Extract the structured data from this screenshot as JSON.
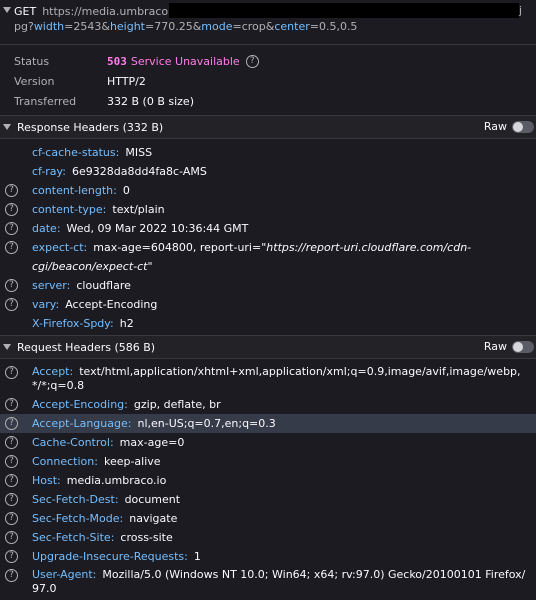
{
  "request_line": {
    "method": "GET",
    "url_prefix": "https://media.umbraco.io",
    "trailing_char": "j",
    "second_line": [
      {
        "text": "pg?",
        "kind": "plain"
      },
      {
        "text": "width",
        "kind": "key"
      },
      {
        "text": "=2543&",
        "kind": "plain"
      },
      {
        "text": "height",
        "kind": "key"
      },
      {
        "text": "=770.25&",
        "kind": "plain"
      },
      {
        "text": "mode",
        "kind": "key"
      },
      {
        "text": "=crop&",
        "kind": "plain"
      },
      {
        "text": "center",
        "kind": "key"
      },
      {
        "text": "=0.5,0.5",
        "kind": "plain"
      }
    ]
  },
  "summary": {
    "status_label": "Status",
    "status_code": "503",
    "status_text": "Service Unavailable",
    "version_label": "Version",
    "version_value": "HTTP/2",
    "transferred_label": "Transferred",
    "transferred_value": "332 B (0 B size)"
  },
  "response_section": {
    "title": "Response Headers (332 B)",
    "raw_label": "Raw",
    "headers": [
      {
        "name": "cf-cache-status",
        "value": "MISS",
        "help": false
      },
      {
        "name": "cf-ray",
        "value": "6e9328da8dd4fa8c-AMS",
        "help": false
      },
      {
        "name": "content-length",
        "value": "0",
        "help": true
      },
      {
        "name": "content-type",
        "value": "text/plain",
        "help": true
      },
      {
        "name": "date",
        "value": "Wed, 09 Mar 2022 10:36:44 GMT",
        "help": true
      },
      {
        "name": "expect-ct",
        "value": "max-age=604800, report-uri=",
        "value_italic": "\"https://report-uri.cloudflare.com/cdn-cgi/beacon/expect-ct\"",
        "help": true
      },
      {
        "name": "server",
        "value": "cloudflare",
        "help": true
      },
      {
        "name": "vary",
        "value": "Accept-Encoding",
        "help": true
      },
      {
        "name": "X-Firefox-Spdy",
        "value": "h2",
        "help": false
      }
    ]
  },
  "request_section": {
    "title": "Request Headers (586 B)",
    "raw_label": "Raw",
    "headers": [
      {
        "name": "Accept",
        "value": "text/html,application/xhtml+xml,application/xml;q=0.9,image/avif,image/webp,*/*;q=0.8",
        "help": true
      },
      {
        "name": "Accept-Encoding",
        "value": "gzip, deflate, br",
        "help": true
      },
      {
        "name": "Accept-Language",
        "value": "nl,en-US;q=0.7,en;q=0.3",
        "help": true,
        "selected": true
      },
      {
        "name": "Cache-Control",
        "value": "max-age=0",
        "help": true
      },
      {
        "name": "Connection",
        "value": "keep-alive",
        "help": true
      },
      {
        "name": "Host",
        "value": "media.umbraco.io",
        "help": true
      },
      {
        "name": "Sec-Fetch-Dest",
        "value": "document",
        "help": true
      },
      {
        "name": "Sec-Fetch-Mode",
        "value": "navigate",
        "help": true
      },
      {
        "name": "Sec-Fetch-Site",
        "value": "cross-site",
        "help": true
      },
      {
        "name": "Upgrade-Insecure-Requests",
        "value": "1",
        "help": true
      },
      {
        "name": "User-Agent",
        "value": "Mozilla/5.0 (Windows NT 10.0; Win64; x64; rv:97.0) Gecko/20100101 Firefox/97.0",
        "help": true
      }
    ]
  },
  "colors": {
    "background": "#1c1b22",
    "header_name": "#75bfff",
    "status_error": "#ff7de9",
    "selected_row": "#353b48"
  }
}
